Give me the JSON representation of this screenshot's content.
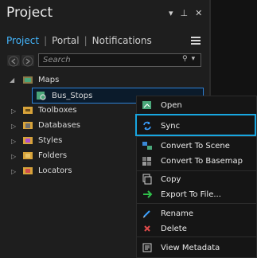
{
  "title": "Project",
  "title_icons": [
    "dropdown-arrow",
    "pin",
    "close"
  ],
  "tabs": [
    {
      "label": "Project",
      "active": true
    },
    {
      "label": "Portal",
      "active": false
    },
    {
      "label": "Notifications",
      "active": false
    }
  ],
  "search": {
    "placeholder": "Search"
  },
  "tree": {
    "maps_label": "Maps",
    "bus_stops_label": "Bus_Stops",
    "toolboxes_label": "Toolboxes",
    "databases_label": "Databases",
    "styles_label": "Styles",
    "folders_label": "Folders",
    "locators_label": "Locators"
  },
  "context_menu": {
    "open": "Open",
    "sync": "Sync",
    "convert_scene": "Convert To Scene",
    "convert_basemap": "Convert To Basemap",
    "copy": "Copy",
    "export": "Export To File...",
    "rename": "Rename",
    "delete": "Delete",
    "view_metadata": "View Metadata"
  },
  "colors": {
    "accent_blue": "#44b7ff",
    "highlight_cyan": "#18a6e0",
    "selected_border": "#2d81d6"
  }
}
